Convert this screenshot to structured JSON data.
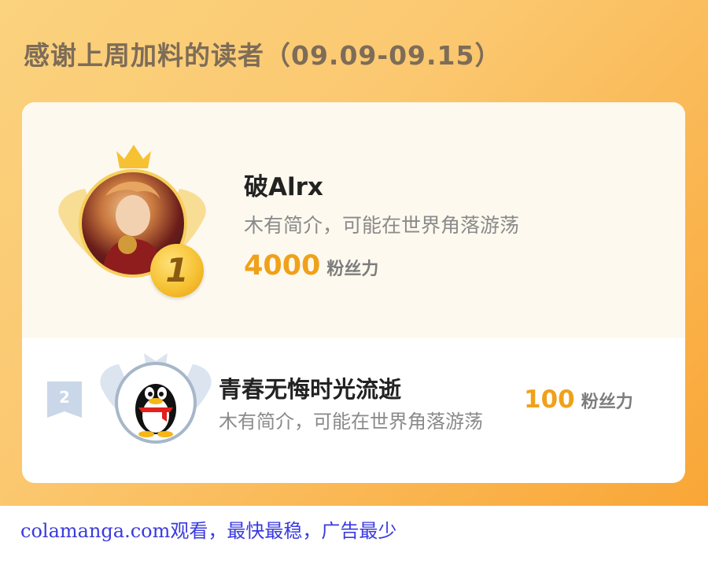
{
  "banner": {
    "title": "感谢上周加料的读者（09.09-09.15）"
  },
  "ranking": [
    {
      "rank": "1",
      "name": "破Alrx",
      "intro": "木有简介，可能在世界角落游荡",
      "power_value": "4000",
      "power_unit": "粉丝力"
    },
    {
      "rank": "2",
      "name": "青春无悔时光流逝",
      "intro": "木有简介，可能在世界角落游荡",
      "power_value": "100",
      "power_unit": "粉丝力"
    }
  ],
  "watermark": "colamanga.com观看，最快最稳，广告最少",
  "colors": {
    "banner_start": "#fbd27e",
    "banner_end": "#f9a636",
    "accent": "#f0a11a",
    "watermark": "#3a3ae0"
  }
}
